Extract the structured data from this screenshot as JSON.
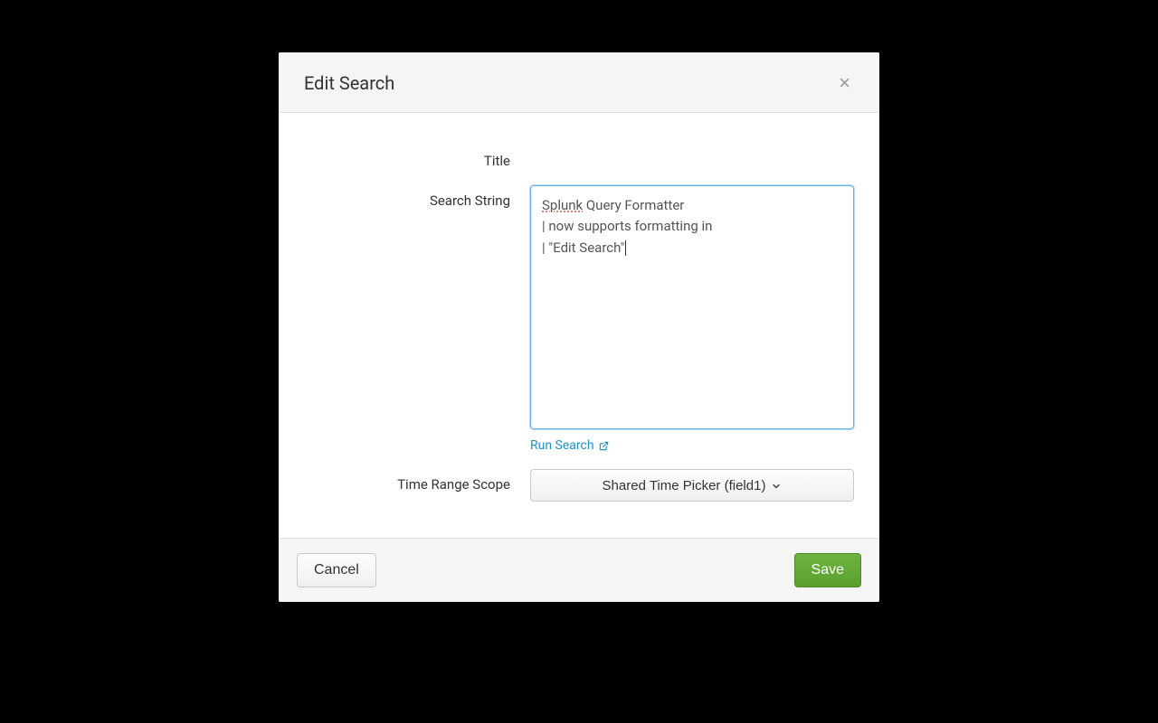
{
  "modal": {
    "title": "Edit Search",
    "close_icon": "×"
  },
  "form": {
    "title_label": "Title",
    "title_value": "",
    "search_string_label": "Search String",
    "search_string_value_line1_word1": "Splunk",
    "search_string_value_line1_rest": " Query Formatter",
    "search_string_value_line2": "| now supports formatting in",
    "search_string_value_line3": "| \"Edit Search\"",
    "run_search_label": "Run Search",
    "time_range_label": "Time Range Scope",
    "time_range_value": "Shared Time Picker (field1)"
  },
  "footer": {
    "cancel_label": "Cancel",
    "save_label": "Save"
  }
}
